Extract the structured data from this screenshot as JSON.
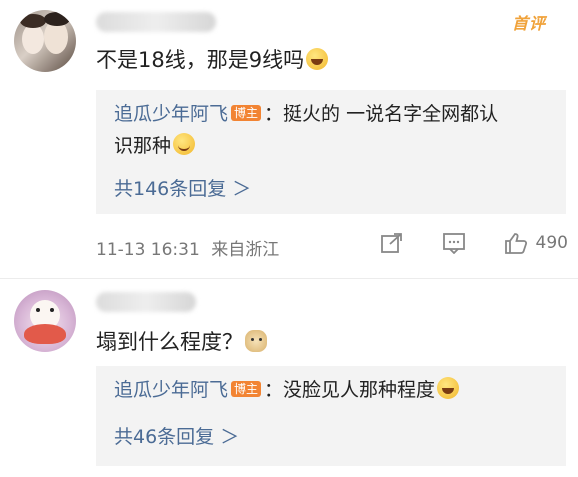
{
  "comments": [
    {
      "username": "",
      "badge": "首评",
      "text": "不是18线，那是9线吗",
      "reply": {
        "author": "追瓜少年阿飞",
        "author_badge": "博主",
        "line1": "：挺火的  一说名字全网都认",
        "line2": "识那种"
      },
      "more_replies": "共146条回复 ＞",
      "time": "11-13 16:31",
      "location": "来自浙江",
      "likes": "490"
    },
    {
      "username": "",
      "text": "塌到什么程度？",
      "reply": {
        "author": "追瓜少年阿飞",
        "author_badge": "博主",
        "line1": "：没脸见人那种程度"
      },
      "more_replies": "共46条回复 ＞"
    }
  ],
  "icons": [
    "forward-icon",
    "comment-icon",
    "like-icon"
  ],
  "colors": {
    "link": "#4b6b95",
    "badge": "#f28433",
    "top_badge": "#f0a23a"
  }
}
